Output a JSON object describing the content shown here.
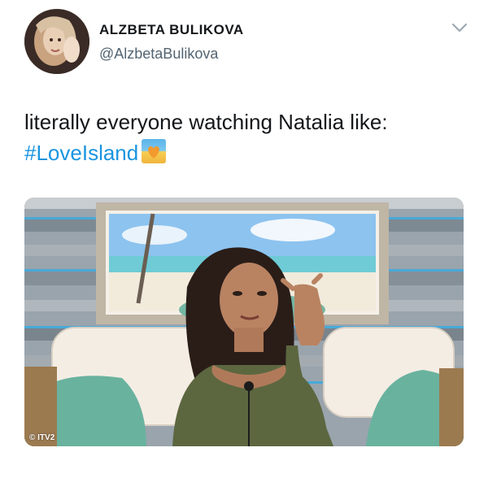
{
  "author": {
    "display_name": "ALZBETA BULIKOVA",
    "handle": "@AlzbetaBulikova"
  },
  "tweet": {
    "text_line1": "literally everyone watching Natalia like:",
    "hashtag": "#LoveIsland",
    "emoji": "beach-heart-emoji"
  },
  "media": {
    "watermark": "ITV2",
    "watermark_icon": "copyright-icon"
  },
  "colors": {
    "hashtag": "#1b95e0",
    "text": "#14171a",
    "handle": "#536471"
  }
}
